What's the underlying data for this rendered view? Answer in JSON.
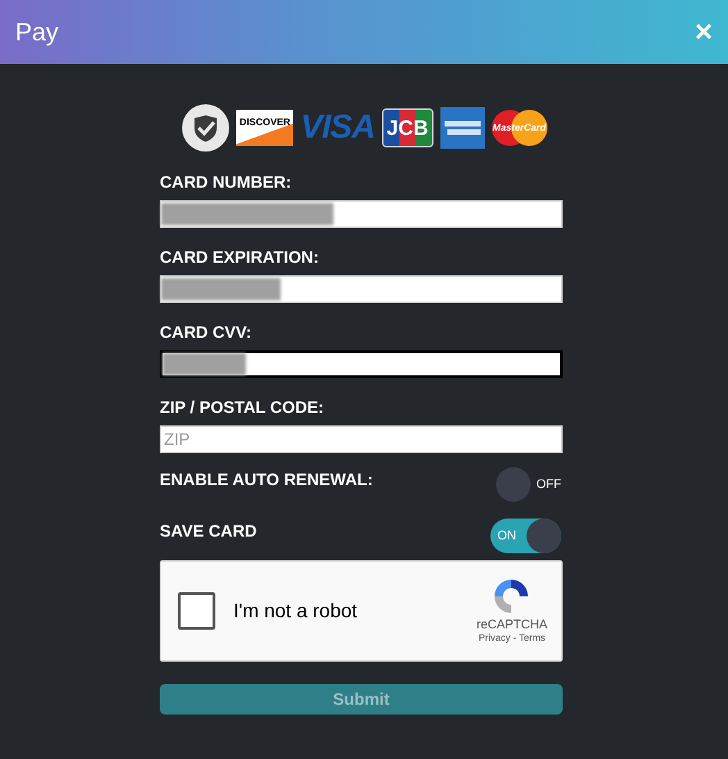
{
  "window": {
    "title": "Pay",
    "close": "×"
  },
  "card_logos": [
    {
      "kind": "shield"
    },
    {
      "kind": "discover",
      "text": "DISCOVER"
    },
    {
      "kind": "visa",
      "text": "VISA"
    },
    {
      "kind": "jcb",
      "text": "JCB"
    },
    {
      "kind": "amex"
    },
    {
      "kind": "mastercard",
      "text": "MasterCard"
    }
  ],
  "fields": [
    {
      "label": "CARD NUMBER:",
      "redacted": true,
      "focused": false
    },
    {
      "label": "CARD EXPIRATION:",
      "redacted": true,
      "focused": false
    },
    {
      "label": "CARD CVV:",
      "redacted": true,
      "focused": true
    },
    {
      "label": "ZIP / POSTAL CODE:",
      "placeholder": "ZIP",
      "focused": false
    }
  ],
  "toggles": [
    {
      "label": "ENABLE AUTO RENEWAL:",
      "on": false,
      "state_text": "OFF"
    },
    {
      "label": "SAVE CARD",
      "on": true,
      "state_text": "ON"
    }
  ],
  "captcha": {
    "checked": false,
    "label": "I'm not a robot",
    "brand": "reCAPTCHA",
    "links": "Privacy - Terms"
  },
  "submit": {
    "label": "Submit",
    "disabled": true
  }
}
